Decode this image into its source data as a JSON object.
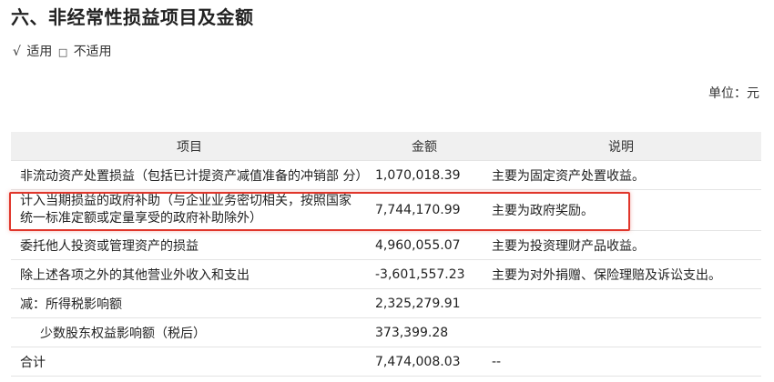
{
  "heading": "六、非经常性损益项目及金额",
  "applicable": {
    "checked_mark": "√",
    "checked_label": "适用",
    "unchecked_mark": "□",
    "unchecked_label": "不适用"
  },
  "unit": "单位：元",
  "table": {
    "headers": [
      "项目",
      "金额",
      "说明"
    ],
    "rows": [
      {
        "item": "非流动资产处置损益（包括已计提资产减值准备的冲销部 分）",
        "amount": "1,070,018.39",
        "desc": "主要为固定资产处置收益。"
      },
      {
        "item": "计入当期损益的政府补助（与企业业务密切相关，按照国家 统一标准定额或定量享受的政府补助除外）",
        "amount": "7,744,170.99",
        "desc": "主要为政府奖励。"
      },
      {
        "item": "委托他人投资或管理资产的损益",
        "amount": "4,960,055.07",
        "desc": "主要为投资理财产品收益。"
      },
      {
        "item": "除上述各项之外的其他营业外收入和支出",
        "amount": "-3,601,557.23",
        "desc": "主要为对外捐赠、保险理赔及诉讼支出。"
      },
      {
        "item": "减：所得税影响额",
        "amount": "2,325,279.91",
        "desc": ""
      },
      {
        "item": "少数股东权益影响额（税后）",
        "amount": "373,399.28",
        "desc": ""
      },
      {
        "item": "合计",
        "amount": "7,474,008.03",
        "desc": "--"
      }
    ]
  },
  "highlight_color": "#e0362b"
}
